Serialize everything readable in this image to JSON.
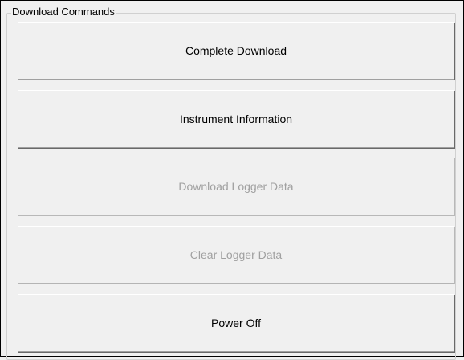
{
  "group": {
    "title": "Download Commands"
  },
  "buttons": [
    {
      "label": "Complete Download",
      "enabled": true
    },
    {
      "label": "Instrument Information",
      "enabled": true
    },
    {
      "label": "Download Logger Data",
      "enabled": false
    },
    {
      "label": "Clear Logger Data",
      "enabled": false
    },
    {
      "label": "Power Off",
      "enabled": true
    }
  ],
  "colors": {
    "background": "#f0f0f0",
    "enabled_text": "#000000",
    "disabled_text": "#a0a0a0"
  }
}
